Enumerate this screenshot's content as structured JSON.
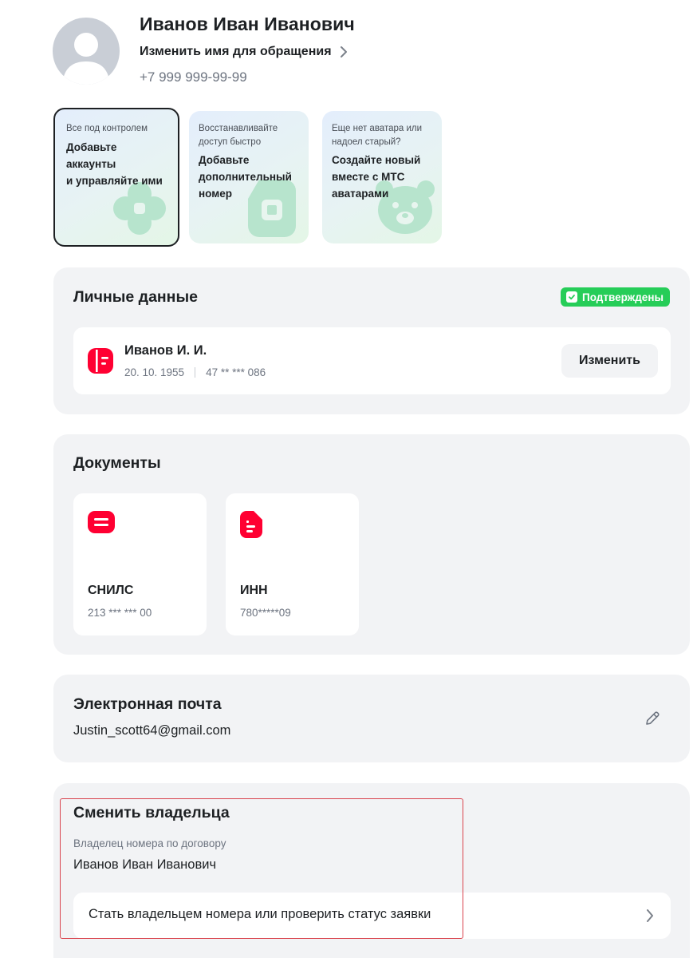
{
  "profile": {
    "name": "Иванов Иван Иванович",
    "change_name_label": "Изменить имя для обращения",
    "phone": "+7 999 999-99-99"
  },
  "promos": [
    {
      "subtitle": "Все под контролем",
      "title": "Добавьте\nаккаунты\nи управляйте ими",
      "icon": "flower-icon"
    },
    {
      "subtitle": "Восстанавливайте доступ быстро",
      "title": "Добавьте\nдополнительный\nномер",
      "icon": "sim-card-icon"
    },
    {
      "subtitle": "Еще нет аватара или надоел старый?",
      "title": "Создайте новый\nвместе с МТС\nаватарами",
      "icon": "bear-icon"
    }
  ],
  "personal": {
    "title": "Личные данные",
    "badge": "Подтверждены",
    "name": "Иванов И. И.",
    "birth_date": "20. 10. 1955",
    "passport": "47 ** *** 086",
    "edit_label": "Изменить"
  },
  "documents": {
    "title": "Документы",
    "items": [
      {
        "title": "СНИЛС",
        "number": "213 *** *** 00",
        "icon": "snils-icon"
      },
      {
        "title": "ИНН",
        "number": "780*****09",
        "icon": "inn-document-icon"
      }
    ]
  },
  "email": {
    "title": "Электронная почта",
    "value": "Justin_scott64@gmail.com"
  },
  "owner": {
    "title": "Сменить владельца",
    "subtitle": "Владелец номера по договору",
    "name": "Иванов Иван Иванович",
    "action_label": "Стать владельцем номера или проверить статус заявки"
  },
  "colors": {
    "accent_red": "#ff0032",
    "badge_green": "#26cd58",
    "section_bg": "#f2f3f5",
    "highlight_border": "#d9434d"
  }
}
